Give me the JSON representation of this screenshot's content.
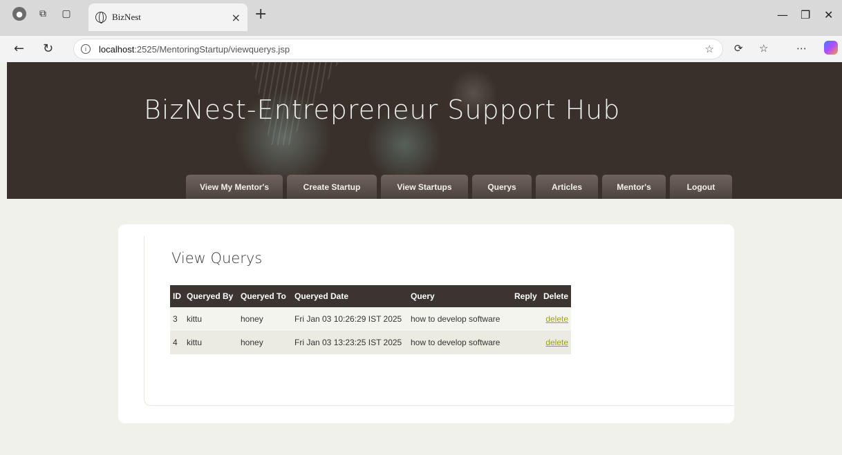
{
  "browser": {
    "tab_title": "BizNest",
    "tab_close": "×",
    "new_tab": "+",
    "url_host": "localhost",
    "url_path": ":2525/MentoringStartup/viewquerys.jsp"
  },
  "header": {
    "title": "BizNest-Entrepreneur Support Hub"
  },
  "menu": [
    {
      "label": "View My Mentor's"
    },
    {
      "label": "Create Startup"
    },
    {
      "label": "View Startups"
    },
    {
      "label": "Querys"
    },
    {
      "label": "Articles"
    },
    {
      "label": "Mentor's"
    },
    {
      "label": "Logout"
    }
  ],
  "content": {
    "heading": "View Querys",
    "columns": [
      "ID",
      "Queryed By",
      "Queryed To",
      "Queryed Date",
      "Query",
      "Reply",
      "Delete"
    ],
    "rows": [
      {
        "id": "3",
        "by": "kittu",
        "to": "honey",
        "date": "Fri Jan 03 10:26:29 IST 2025",
        "query": "how to develop software",
        "reply": "",
        "delete": "delete"
      },
      {
        "id": "4",
        "by": "kittu",
        "to": "honey",
        "date": "Fri Jan 03 13:23:25 IST 2025",
        "query": "how to develop software",
        "reply": "",
        "delete": "delete"
      }
    ]
  },
  "colors": {
    "header_bg": "#3a302b",
    "table_header_bg": "#3b3430",
    "link": "#9aa01a"
  }
}
